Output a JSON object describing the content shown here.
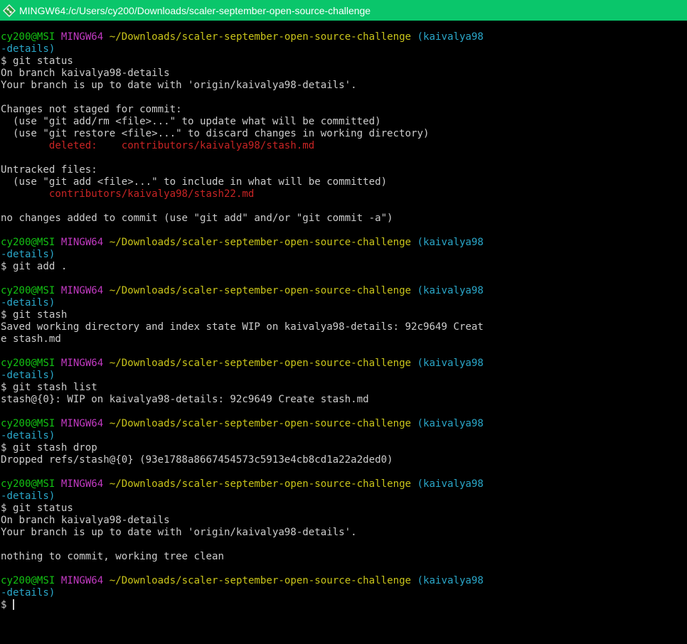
{
  "window": {
    "title": "MINGW64:/c/Users/cy200/Downloads/scaler-september-open-source-challenge",
    "icon": "git-bash-icon"
  },
  "colors": {
    "titlebar": "#0ac66b",
    "background": "#000000",
    "text": "#cccccc",
    "user_host": "#13c213",
    "mingw": "#c23ac2",
    "path": "#c9c41a",
    "branch": "#2aa7c9",
    "file_changes": "#c82424"
  },
  "prompt": {
    "user_host": "cy200@MSI",
    "env": "MINGW64",
    "path": "~/Downloads/scaler-september-open-source-challenge",
    "branch_part1": "(kaivalya98",
    "branch_part2": "-details)"
  },
  "blocks": [
    {
      "command": "$ git status",
      "output": [
        "On branch kaivalya98-details",
        "Your branch is up to date with 'origin/kaivalya98-details'.",
        "",
        "Changes not staged for commit:",
        "  (use \"git add/rm <file>...\" to update what will be committed)",
        "  (use \"git restore <file>...\" to discard changes in working directory)"
      ],
      "deleted_line": "        deleted:    contributors/kaivalya98/stash.md",
      "output2": [
        "",
        "Untracked files:",
        "  (use \"git add <file>...\" to include in what will be committed)"
      ],
      "untracked_line": "        contributors/kaivalya98/stash22.md",
      "output3": [
        "",
        "no changes added to commit (use \"git add\" and/or \"git commit -a\")"
      ]
    },
    {
      "command": "$ git add ."
    },
    {
      "command": "$ git stash",
      "output": [
        "Saved working directory and index state WIP on kaivalya98-details: 92c9649 Creat",
        "e stash.md"
      ]
    },
    {
      "command": "$ git stash list",
      "output": [
        "stash@{0}: WIP on kaivalya98-details: 92c9649 Create stash.md"
      ]
    },
    {
      "command": "$ git stash drop",
      "output": [
        "Dropped refs/stash@{0} (93e1788a8667454573c5913e4cb8cd1a22a2ded0)"
      ]
    },
    {
      "command": "$ git status",
      "output": [
        "On branch kaivalya98-details",
        "Your branch is up to date with 'origin/kaivalya98-details'.",
        "",
        "nothing to commit, working tree clean"
      ]
    }
  ],
  "final_prompt_symbol": "$ "
}
